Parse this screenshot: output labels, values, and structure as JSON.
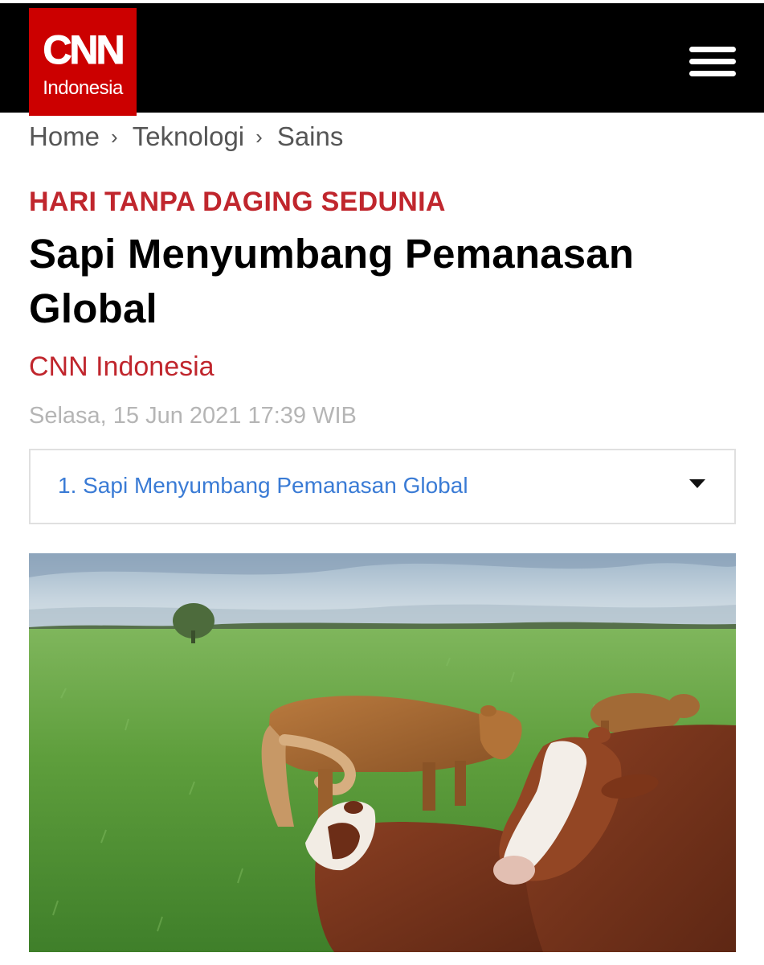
{
  "header": {
    "logo_main": "CNN",
    "logo_sub": "Indonesia",
    "brand_color": "#cc0000",
    "menu_icon": "hamburger-menu-icon"
  },
  "breadcrumb": {
    "items": [
      "Home",
      "Teknologi",
      "Sains"
    ],
    "separator": "›"
  },
  "article": {
    "kicker": "HARI TANPA DAGING SEDUNIA",
    "kicker_color": "#c0262d",
    "title": "Sapi Menyumbang Pemanasan Global",
    "source": "CNN Indonesia",
    "date": "Selasa, 15 Jun 2021 17:39 WIB"
  },
  "page_selector": {
    "selected": "1. Sapi Menyumbang Pemanasan Global",
    "icon": "caret-down-icon"
  },
  "photo": {
    "subject": "cows-in-pasture-photo"
  }
}
